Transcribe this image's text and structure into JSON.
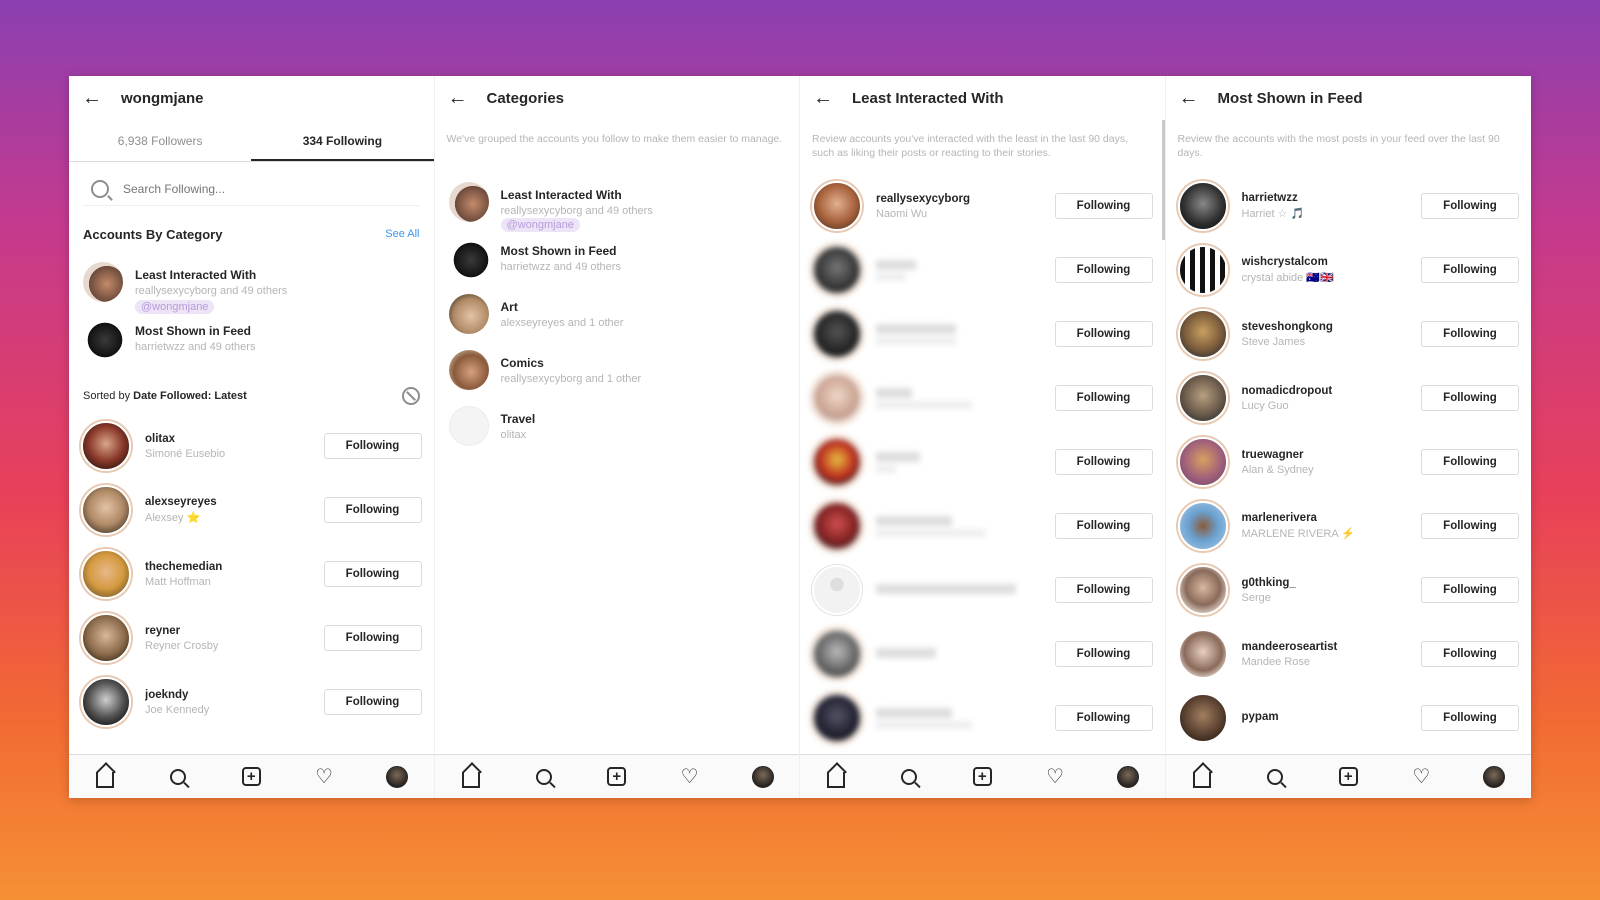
{
  "colors": {
    "link_blue": "#3897f0",
    "text": "#262626",
    "muted": "#b5b5b5",
    "border": "#dbdbdb"
  },
  "panel1": {
    "title": "wongmjane",
    "tabs": [
      "6,938 Followers",
      "334 Following"
    ],
    "search_placeholder": "Search Following...",
    "section_title": "Accounts By Category",
    "see_all": "See All",
    "categories": [
      {
        "name": "Least Interacted With",
        "sub": "reallysexycyborg and 49 others"
      },
      {
        "name": "Most Shown in Feed",
        "sub": "harrietwzz and 49 others"
      }
    ],
    "mention": "@wongmjane",
    "sort_prefix": "Sorted by ",
    "sort_value": "Date Followed: Latest",
    "rows": [
      {
        "username": "olitax",
        "fullname": "Simoné Eusebio",
        "button": "Following"
      },
      {
        "username": "alexseyreyes",
        "fullname": "Alexsey ⭐",
        "button": "Following"
      },
      {
        "username": "thechemedian",
        "fullname": "Matt Hoffman",
        "button": "Following"
      },
      {
        "username": "reyner",
        "fullname": "Reyner Crosby",
        "button": "Following"
      },
      {
        "username": "joekndy",
        "fullname": "Joe Kennedy",
        "button": "Following"
      }
    ]
  },
  "panel2": {
    "title": "Categories",
    "description": "We've grouped the accounts you follow to make them easier to manage.",
    "mention": "@wongmjane",
    "categories": [
      {
        "name": "Least Interacted With",
        "sub": "reallysexycyborg and 49 others"
      },
      {
        "name": "Most Shown in Feed",
        "sub": "harrietwzz and 49 others"
      },
      {
        "name": "Art",
        "sub": "alexseyreyes and 1 other"
      },
      {
        "name": "Comics",
        "sub": "reallysexycyborg and 1 other"
      },
      {
        "name": "Travel",
        "sub": "olitax"
      }
    ]
  },
  "panel3": {
    "title": "Least Interacted With",
    "description": "Review accounts you've interacted with the least in the last 90 days, such as liking their posts or reacting to their stories.",
    "rows": [
      {
        "username": "reallysexycyborg",
        "fullname": "Naomi Wu",
        "button": "Following"
      },
      {
        "username": "",
        "fullname": "",
        "button": "Following"
      },
      {
        "username": "",
        "fullname": "",
        "button": "Following"
      },
      {
        "username": "",
        "fullname": "",
        "button": "Following"
      },
      {
        "username": "",
        "fullname": "",
        "button": "Following"
      },
      {
        "username": "",
        "fullname": "",
        "button": "Following"
      },
      {
        "username": "",
        "fullname": "",
        "button": "Following"
      },
      {
        "username": "",
        "fullname": "",
        "button": "Following"
      },
      {
        "username": "",
        "fullname": "",
        "button": "Following"
      }
    ]
  },
  "panel4": {
    "title": "Most Shown in Feed",
    "description": "Review the accounts with the most posts in your feed over the last 90 days.",
    "rows": [
      {
        "username": "harrietwzz",
        "fullname": "Harriet ☆ 🎵",
        "button": "Following"
      },
      {
        "username": "wishcrystalcom",
        "fullname": "crystal abide 🇦🇺🇬🇧",
        "button": "Following"
      },
      {
        "username": "steveshongkong",
        "fullname": "Steve James",
        "button": "Following"
      },
      {
        "username": "nomadicdropout",
        "fullname": "Lucy Guo",
        "button": "Following"
      },
      {
        "username": "truewagner",
        "fullname": "Alan & Sydney",
        "button": "Following"
      },
      {
        "username": "marlenerivera",
        "fullname": "MARLENE RIVERA ⚡",
        "button": "Following"
      },
      {
        "username": "g0thking_",
        "fullname": "Serge",
        "button": "Following"
      },
      {
        "username": "mandeeroseartist",
        "fullname": "Mandee Rose",
        "button": "Following"
      },
      {
        "username": "pypam",
        "fullname": "",
        "button": "Following"
      }
    ]
  },
  "nav_icons": [
    "home-icon",
    "search-icon",
    "add-post-icon",
    "heart-icon",
    "profile-icon"
  ]
}
